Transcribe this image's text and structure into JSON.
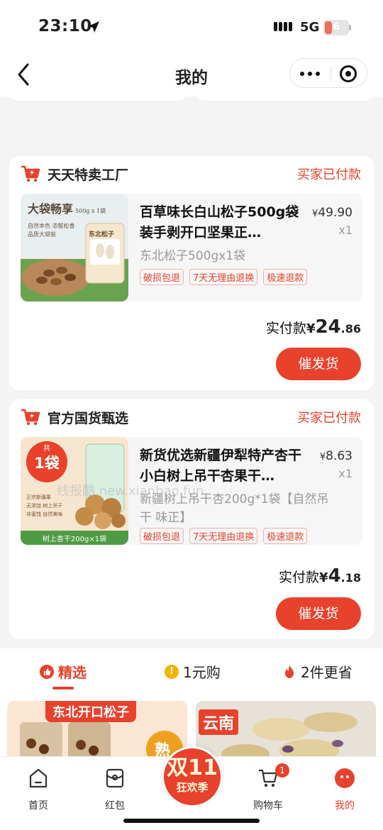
{
  "status_bar": {
    "time": "23:10",
    "network": "5G",
    "battery": "6"
  },
  "nav": {
    "title": "我的"
  },
  "orders": [
    {
      "shop": "天天特卖工厂",
      "status": "买家已付款",
      "thumb_banner": "大袋畅享",
      "thumb_banner_sub": "500g x 1袋",
      "thumb_line1": "自然本色 浓郁松香",
      "thumb_line2": "品质大袋装",
      "thumb_pack": "东北松子",
      "title": "百草味长白山松子500g袋装手剥开口坚果正…",
      "price_cur": "¥",
      "price": "49.90",
      "qty": "x1",
      "spec": "东北松子500gx1袋",
      "tags": [
        "破损包退",
        "7天无理由退换",
        "极速退款"
      ],
      "paid_label": "实付款",
      "paid_cur": "¥",
      "paid_int": "24",
      "paid_dec": ".86",
      "button": "催发货"
    },
    {
      "shop": "官方国货甄选",
      "status": "买家已付款",
      "thumb_badge_top": "共",
      "thumb_badge": "1袋",
      "thumb_features": [
        "正宗新疆果",
        "无添加 树上吊干",
        "非蜜饯 自然美味"
      ],
      "thumb_footer": "树上杏干200g×1袋",
      "title": "新货优选新疆伊犁特产杏干小白树上吊干杏果干…",
      "price_cur": "¥",
      "price": "8.63",
      "qty": "x1",
      "spec": "新疆树上吊干杏200g*1袋【自然吊干 味正】",
      "tags": [
        "破损包退",
        "7天无理由退换",
        "极速退款"
      ],
      "paid_label": "实付款",
      "paid_cur": "¥",
      "paid_int": "4",
      "paid_dec": ".18",
      "button": "催发货"
    }
  ],
  "watermark": "线报酷 new.xianbao.fun",
  "rec_tabs": [
    {
      "label": "精选",
      "icon": "thumbs-up-icon"
    },
    {
      "label": "1元购",
      "icon": "coin-icon"
    },
    {
      "label": "2件更省",
      "icon": "flame-icon"
    }
  ],
  "rec_items": [
    {
      "label": "东北开口松子",
      "tag": "熟"
    },
    {
      "label": "云南"
    }
  ],
  "tabbar": {
    "items": [
      {
        "label": "首页",
        "icon": "home-icon"
      },
      {
        "label": "红包",
        "icon": "red-packet-icon"
      },
      {
        "label": "购物车",
        "icon": "cart-icon"
      },
      {
        "label": "我的",
        "icon": "profile-icon"
      }
    ],
    "promo_big": "双11",
    "promo_small": "狂欢季",
    "cart_badge": "1",
    "active": "我的"
  },
  "colors": {
    "accent": "#e8412c",
    "background": "#f4f4f4"
  }
}
